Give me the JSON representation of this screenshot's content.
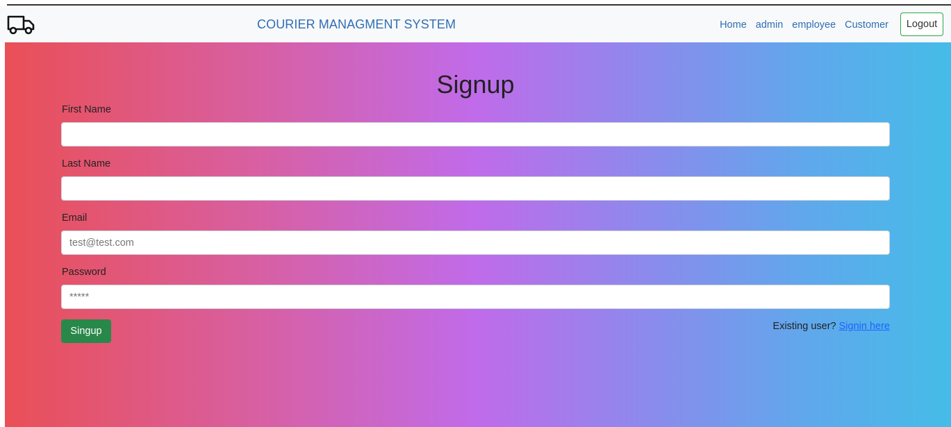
{
  "navbar": {
    "brand": "COURIER MANAGMENT SYSTEM",
    "icon": "truck-icon",
    "links": [
      "Home",
      "admin",
      "employee",
      "Customer"
    ],
    "logout_label": "Logout",
    "link_color": "#2f6db5",
    "logout_border_color": "#28a745"
  },
  "form": {
    "title": "Signup",
    "first_name": {
      "label": "First Name",
      "value": ""
    },
    "last_name": {
      "label": "Last Name",
      "value": ""
    },
    "email": {
      "label": "Email",
      "placeholder": "test@test.com"
    },
    "password": {
      "label": "Password",
      "placeholder": "*****"
    },
    "submit_label": "Singup",
    "submit_color": "#28884a",
    "existing_text": "Existing user?",
    "signin_link": "Signin here"
  },
  "background_gradient": [
    "#ea4f55",
    "#d760a5",
    "#c06bea",
    "#8c8aec",
    "#5fa8ec",
    "#45bce8"
  ]
}
